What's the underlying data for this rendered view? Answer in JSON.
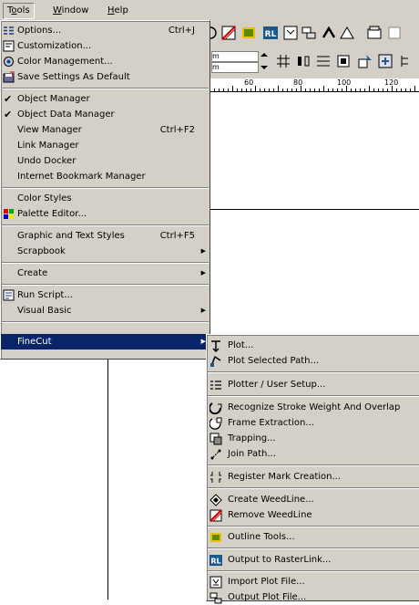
{
  "menubar": {
    "items": [
      {
        "label": "Tools",
        "underline_index": 1
      },
      {
        "label": "Window",
        "underline_index": 0
      },
      {
        "label": "Help",
        "underline_index": 0
      }
    ]
  },
  "ruler": {
    "ticks": [
      "60",
      "80",
      "100",
      "120"
    ]
  },
  "toolbar": {
    "unit_a": "m",
    "unit_b": "m"
  },
  "tools_menu": {
    "items": [
      {
        "label": "Options...",
        "shortcut": "Ctrl+J",
        "icon": "options-icon"
      },
      {
        "label": "Customization...",
        "icon": "customization-icon"
      },
      {
        "label": "Color Management...",
        "icon": "color-management-icon"
      },
      {
        "label": "Save Settings As Default",
        "icon": "save-settings-icon"
      },
      {
        "label": "Object Manager",
        "checked": true
      },
      {
        "label": "Object Data Manager",
        "checked": true
      },
      {
        "label": "View Manager",
        "shortcut": "Ctrl+F2"
      },
      {
        "label": "Link Manager"
      },
      {
        "label": "Undo Docker"
      },
      {
        "label": "Internet Bookmark Manager"
      },
      {
        "label": "Color Styles"
      },
      {
        "label": "Palette Editor...",
        "icon": "palette-editor-icon"
      },
      {
        "label": "Graphic and Text Styles",
        "shortcut": "Ctrl+F5"
      },
      {
        "label": "Scrapbook",
        "submenu": true
      },
      {
        "label": "Create",
        "submenu": true
      },
      {
        "label": "Run Script...",
        "icon": "run-script-icon"
      },
      {
        "label": "Visual Basic",
        "submenu": true
      },
      {
        "label": "FineCut",
        "submenu": true,
        "selected": true
      }
    ]
  },
  "finecut_menu": {
    "items": [
      {
        "label": "Plot...",
        "icon": "plot-icon"
      },
      {
        "label": "Plot Selected Path...",
        "icon": "plot-selected-path-icon"
      },
      {
        "label": "Plotter / User Setup...",
        "icon": "plotter-setup-icon"
      },
      {
        "label": "Recognize Stroke Weight And Overlap",
        "icon": "recognize-stroke-icon"
      },
      {
        "label": "Frame Extraction...",
        "icon": "frame-extraction-icon"
      },
      {
        "label": "Trapping...",
        "icon": "trapping-icon"
      },
      {
        "label": "Join Path...",
        "icon": "join-path-icon"
      },
      {
        "label": "Register Mark Creation...",
        "icon": "register-mark-icon"
      },
      {
        "label": "Create WeedLine...",
        "icon": "create-weedline-icon"
      },
      {
        "label": "Remove WeedLine",
        "icon": "remove-weedline-icon"
      },
      {
        "label": "Outline Tools...",
        "icon": "outline-tools-icon"
      },
      {
        "label": "Output to RasterLink...",
        "icon": "rasterlink-icon",
        "icon_text": "RL"
      },
      {
        "label": "Import Plot File...",
        "icon": "import-plot-file-icon"
      },
      {
        "label": "Output Plot File...",
        "icon": "output-plot-file-icon"
      }
    ]
  }
}
